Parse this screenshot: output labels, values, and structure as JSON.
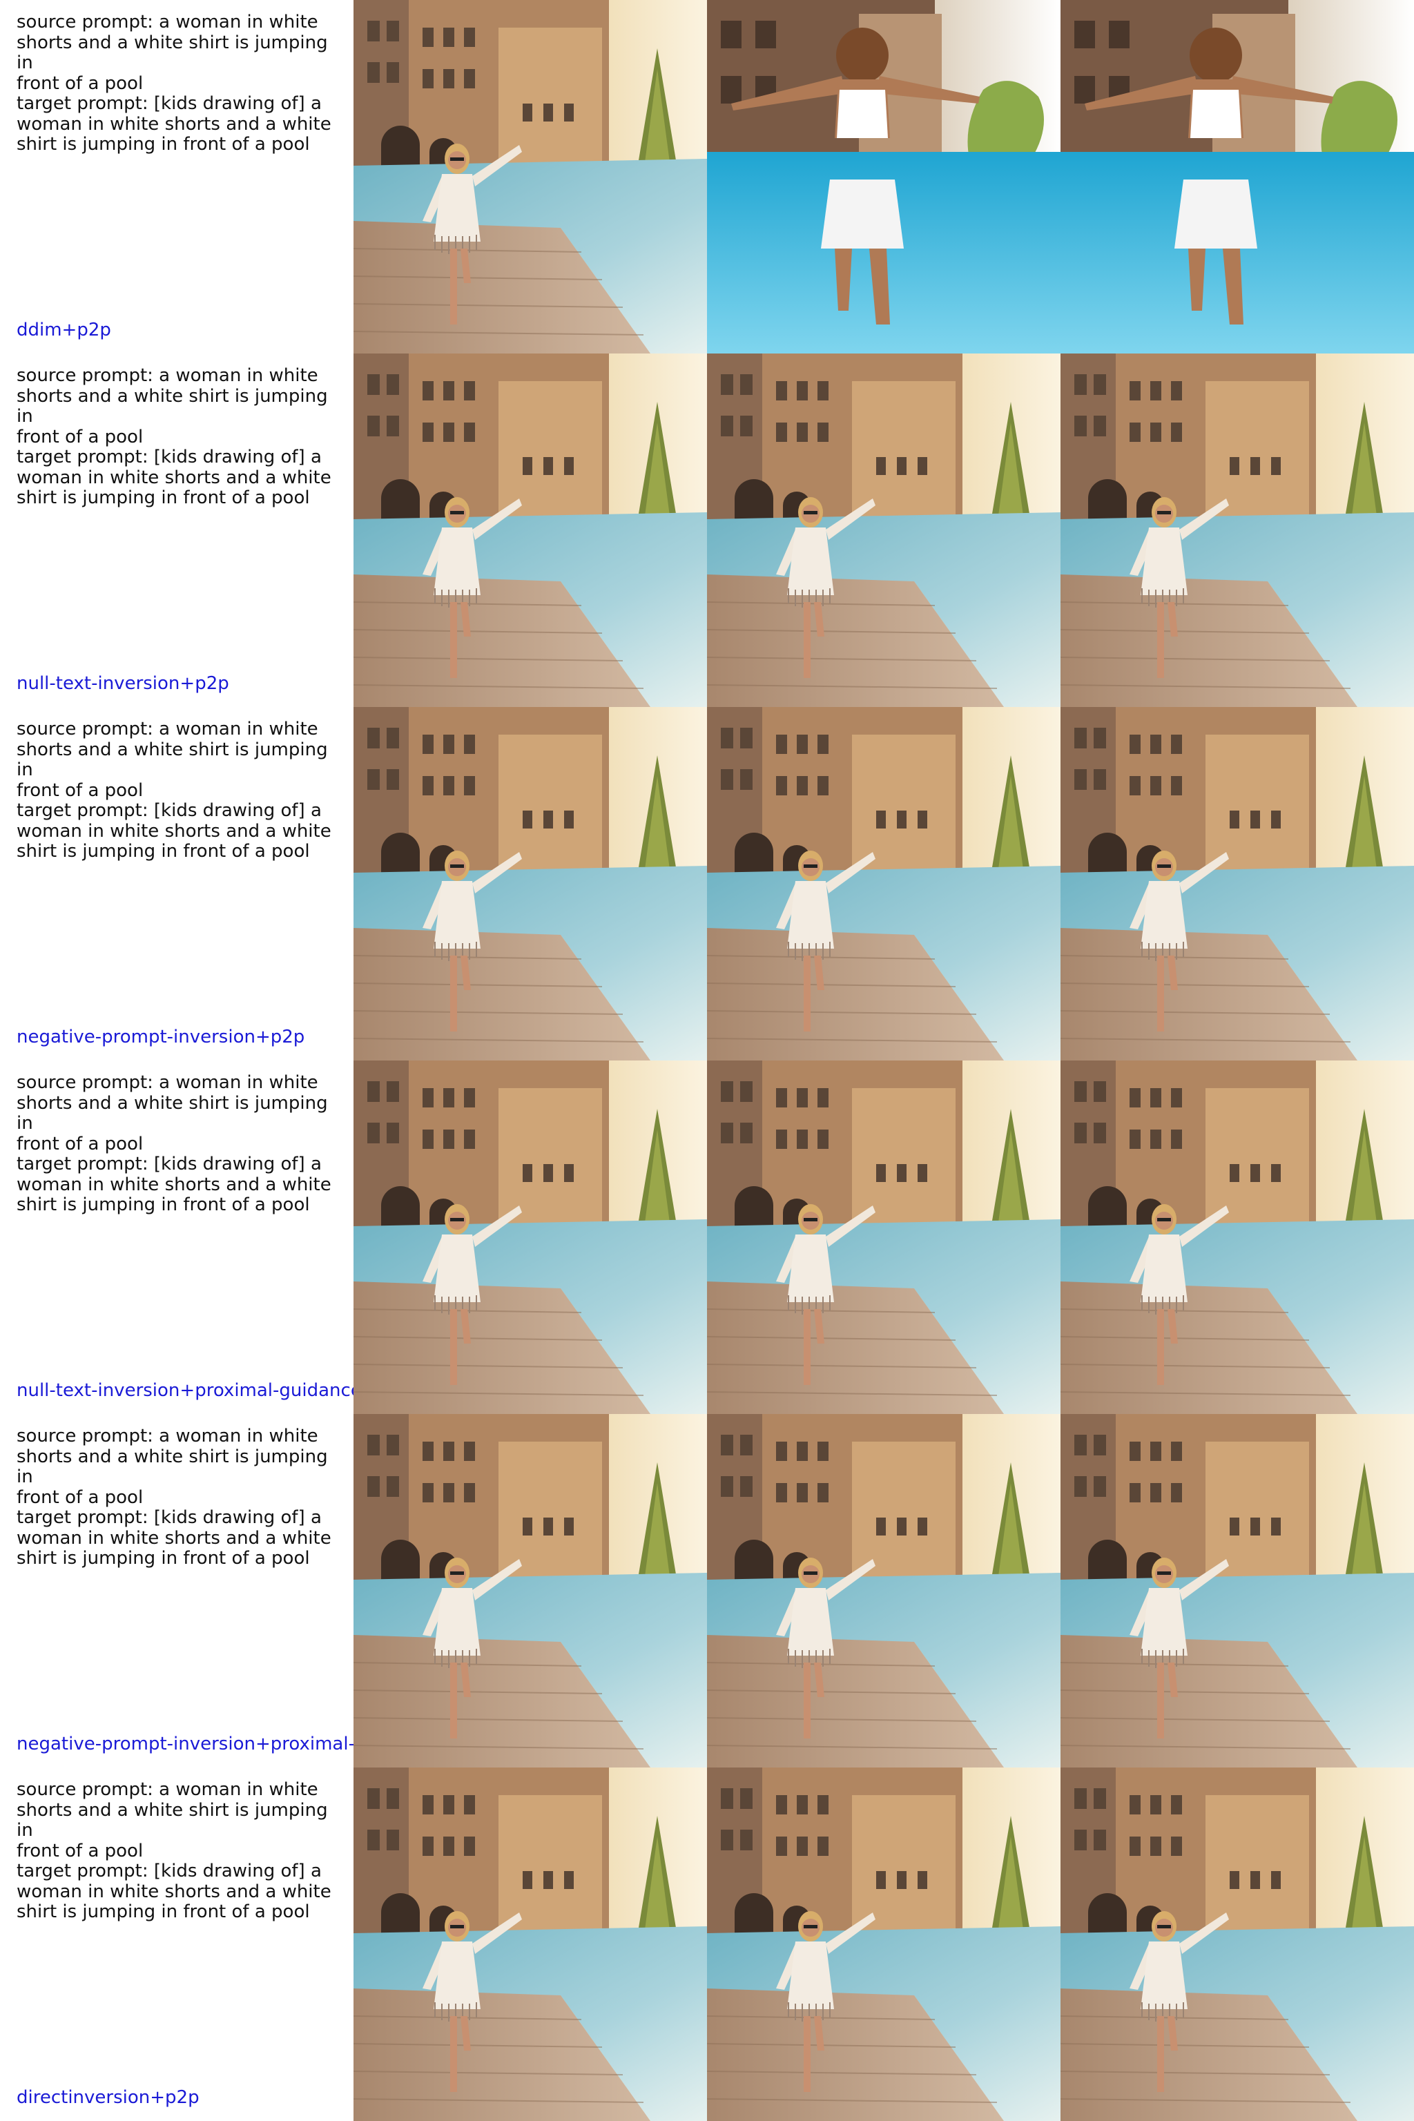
{
  "rows": [
    {
      "prompt_text": "source prompt: a woman in white\nshorts and a white shirt is jumping in\nfront of a pool\ntarget prompt: [kids drawing of] a\nwoman in white shorts and a white\nshirt is jumping in front of a pool",
      "method": "ddim+p2p"
    },
    {
      "prompt_text": "source prompt: a woman in white\nshorts and a white shirt is jumping in\nfront of a pool\ntarget prompt: [kids drawing of] a\nwoman in white shorts and a white\nshirt is jumping in front of a pool",
      "method": "null-text-inversion+p2p"
    },
    {
      "prompt_text": "source prompt: a woman in white\nshorts and a white shirt is jumping in\nfront of a pool\ntarget prompt: [kids drawing of] a\nwoman in white shorts and a white\nshirt is jumping in front of a pool",
      "method": "negative-prompt-inversion+p2p"
    },
    {
      "prompt_text": "source prompt: a woman in white\nshorts and a white shirt is jumping in\nfront of a pool\ntarget prompt: [kids drawing of] a\nwoman in white shorts and a white\nshirt is jumping in front of a pool",
      "method": "null-text-inversion+proximal-guidance"
    },
    {
      "prompt_text": "source prompt: a woman in white\nshorts and a white shirt is jumping in\nfront of a pool\ntarget prompt: [kids drawing of] a\nwoman in white shorts and a white\nshirt is jumping in front of a pool",
      "method": "negative-prompt-inversion+proximal-g"
    },
    {
      "prompt_text": "source prompt: a woman in white\nshorts and a white shirt is jumping in\nfront of a pool\ntarget prompt: [kids drawing of] a\nwoman in white shorts and a white\nshirt is jumping in front of a pool",
      "method": "directinversion+p2p"
    }
  ],
  "colors": {
    "method_label": "#1a1ad6",
    "prompt_text": "#111111"
  }
}
